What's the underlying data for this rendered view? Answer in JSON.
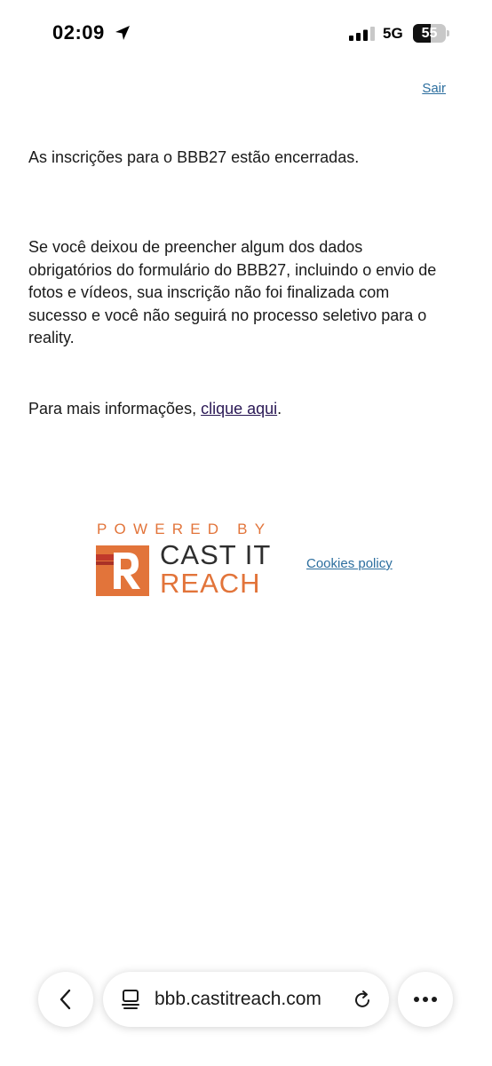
{
  "status_bar": {
    "time": "02:09",
    "network": "5G",
    "battery_level": 55,
    "battery_text": "55",
    "icons": [
      "location-arrow-icon",
      "signal-bars-icon",
      "battery-icon"
    ]
  },
  "page": {
    "logout_label": "Sair",
    "closed_notice": "As inscrições para o BBB27 estão encerradas.",
    "incomplete_notice": "Se você deixou de preencher algum dos dados obrigatórios do formulário do BBB27, incluindo o envio de fotos e vídeos, sua inscrição não foi finalizada com sucesso e você não seguirá no processo seletivo para o reality.",
    "more_info_prefix": "Para mais informações, ",
    "more_info_link": "clique aqui",
    "more_info_suffix": ".",
    "cookies_link": "Cookies policy"
  },
  "logo": {
    "powered_by": "POWERED BY",
    "line1": "CAST IT",
    "line2": "REACH",
    "brand_orange": "#E2743A",
    "brand_dark": "#2E2E2E"
  },
  "browser": {
    "url": "bbb.castitreach.com",
    "icons": [
      "back-chevron-icon",
      "page-tabs-icon",
      "reload-icon",
      "more-dots-icon"
    ]
  }
}
